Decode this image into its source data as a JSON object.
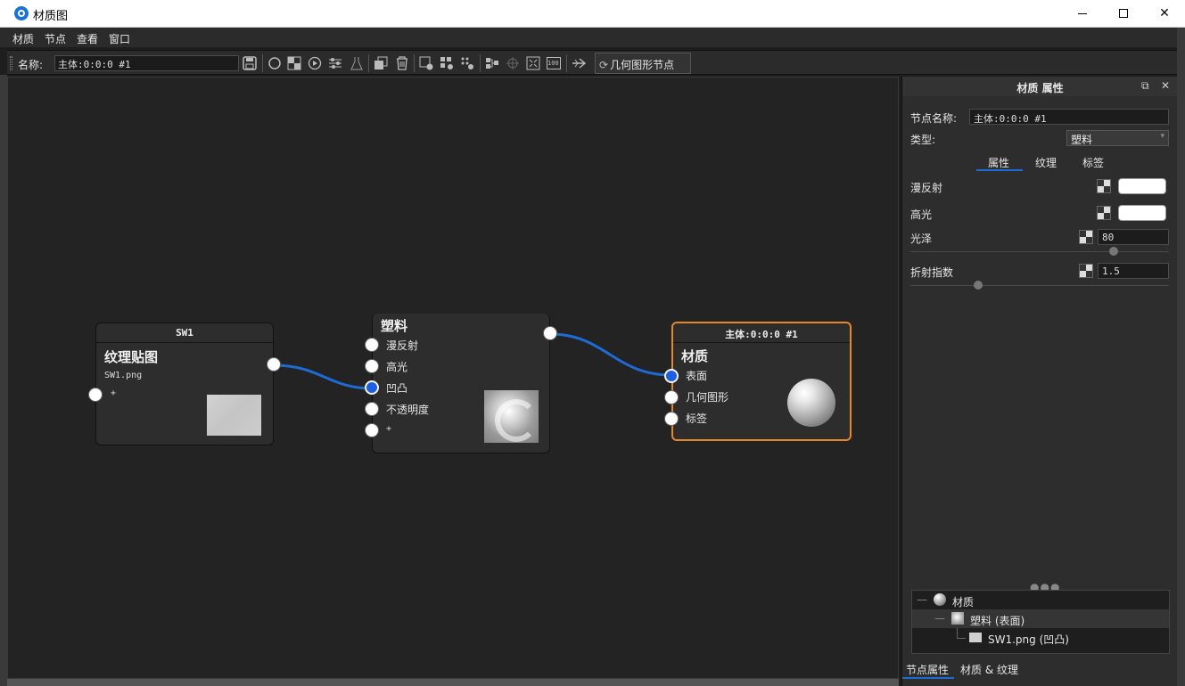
{
  "window": {
    "title": "材质图"
  },
  "menu": {
    "items": [
      "材质",
      "节点",
      "查看",
      "窗口"
    ]
  },
  "toolbar": {
    "name_label": "名称:",
    "name_value": "主体:0:0:0 #1",
    "geometry_node_button": "几何图形节点",
    "icons": [
      "save-icon",
      "sphere-preview-icon",
      "checker-icon",
      "play-icon",
      "sliders-icon",
      "flask-icon",
      "copy-icon",
      "trash-icon",
      "add-node-icon",
      "grid-node-icon",
      "dots-node-icon",
      "layout-icon",
      "center-icon",
      "fit-icon",
      "zoom-100-icon",
      "connect-icon"
    ],
    "zoom_label": "100"
  },
  "nodes": {
    "texture": {
      "header": "SW1",
      "title": "纹理贴图",
      "file": "SW1.png",
      "plus": "+"
    },
    "plastic": {
      "title": "塑料",
      "inputs": [
        "漫反射",
        "高光",
        "凹凸",
        "不透明度",
        "+"
      ]
    },
    "material": {
      "header": "主体:0:0:0 #1",
      "title": "材质",
      "inputs": [
        "表面",
        "几何图形",
        "标签"
      ]
    }
  },
  "panel": {
    "title": "材质 属性",
    "node_name_label": "节点名称:",
    "node_name_value": "主体:0:0:0 #1",
    "type_label": "类型:",
    "type_value": "塑料",
    "tabs": [
      "属性",
      "纹理",
      "标签"
    ],
    "diffuse_label": "漫反射",
    "specular_label": "高光",
    "gloss_label": "光泽",
    "gloss_value": "80",
    "ior_label": "折射指数",
    "ior_value": "1.5",
    "more": "●●●",
    "tree": [
      {
        "label": "材质",
        "collapse": "—"
      },
      {
        "label": "塑料 (表面)",
        "collapse": "—"
      },
      {
        "label": "SW1.png (凹凸)"
      }
    ],
    "bottom_tabs": [
      "节点属性",
      "材质 & 纹理"
    ]
  },
  "colors": {
    "accent": "#1e6bd6",
    "selected_node": "#e8862a",
    "wire": "#1e6bd6"
  }
}
